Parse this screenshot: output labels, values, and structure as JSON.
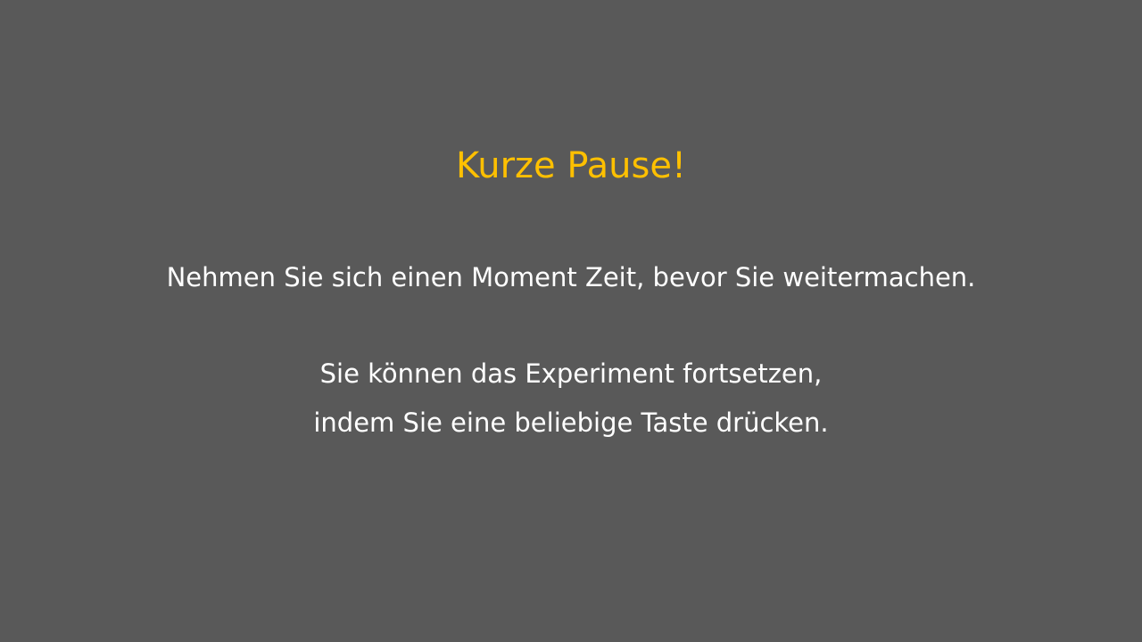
{
  "screen": {
    "background_color": "#595959",
    "title": "Kurze Pause!",
    "title_color": "#FFC000",
    "text_color": "#FFFFFF",
    "instruction": "Nehmen Sie sich einen Moment Zeit, bevor Sie weitermachen.",
    "continue_line_1": "Sie können das Experiment fortsetzen,",
    "continue_line_2": "indem Sie eine beliebige Taste drücken."
  }
}
